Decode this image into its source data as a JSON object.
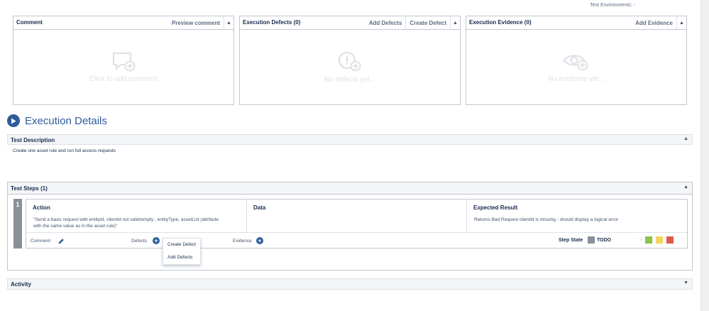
{
  "top": {
    "test_environments": "Test Environments: -"
  },
  "comment_panel": {
    "title": "Comment",
    "action": "Preview comment",
    "empty": "Click to add comment",
    "icon": "comment-plus-icon"
  },
  "defects_panel": {
    "title": "Execution Defects (0)",
    "actions": [
      "Add Defects",
      "Create Defect"
    ],
    "empty": "No defects yet...",
    "icon": "alert-plus-icon"
  },
  "evidence_panel": {
    "title": "Execution Evidence (0)",
    "action": "Add Evidence",
    "empty": "No evidence yet...",
    "icon": "eye-plus-icon"
  },
  "execution": {
    "title": "Execution Details"
  },
  "description": {
    "title": "Test Description",
    "text": "Create one asset rule and run full access requests"
  },
  "steps": {
    "title": "Test Steps (1)",
    "items": [
      {
        "number": "1",
        "action_header": "Action",
        "action_line1": "\"Send a basic request with entityId, clientId not valid/empty , entityType, assetList (attribute",
        "action_line2": "with the same value as in the asset rule)\"",
        "data_header": "Data",
        "expected_header": "Expected Result",
        "expected_text": "Returns Bad Request clientId is missing - should display a logical error",
        "comment_label": "Comment",
        "defects_label": "Defects",
        "evidence_label": "Evidence",
        "step_state_label": "Step State",
        "state": "TODO",
        "state_code": "⁻/₋"
      }
    ]
  },
  "dropdown": {
    "items": [
      "Create Defect",
      "Add Defects"
    ]
  },
  "activity": {
    "title": "Activity"
  },
  "colors": {
    "accent": "#2e5b9a",
    "todo": "#8a9099",
    "pass": "#8bc34a",
    "executing": "#f4d35e",
    "fail": "#e2574c"
  }
}
